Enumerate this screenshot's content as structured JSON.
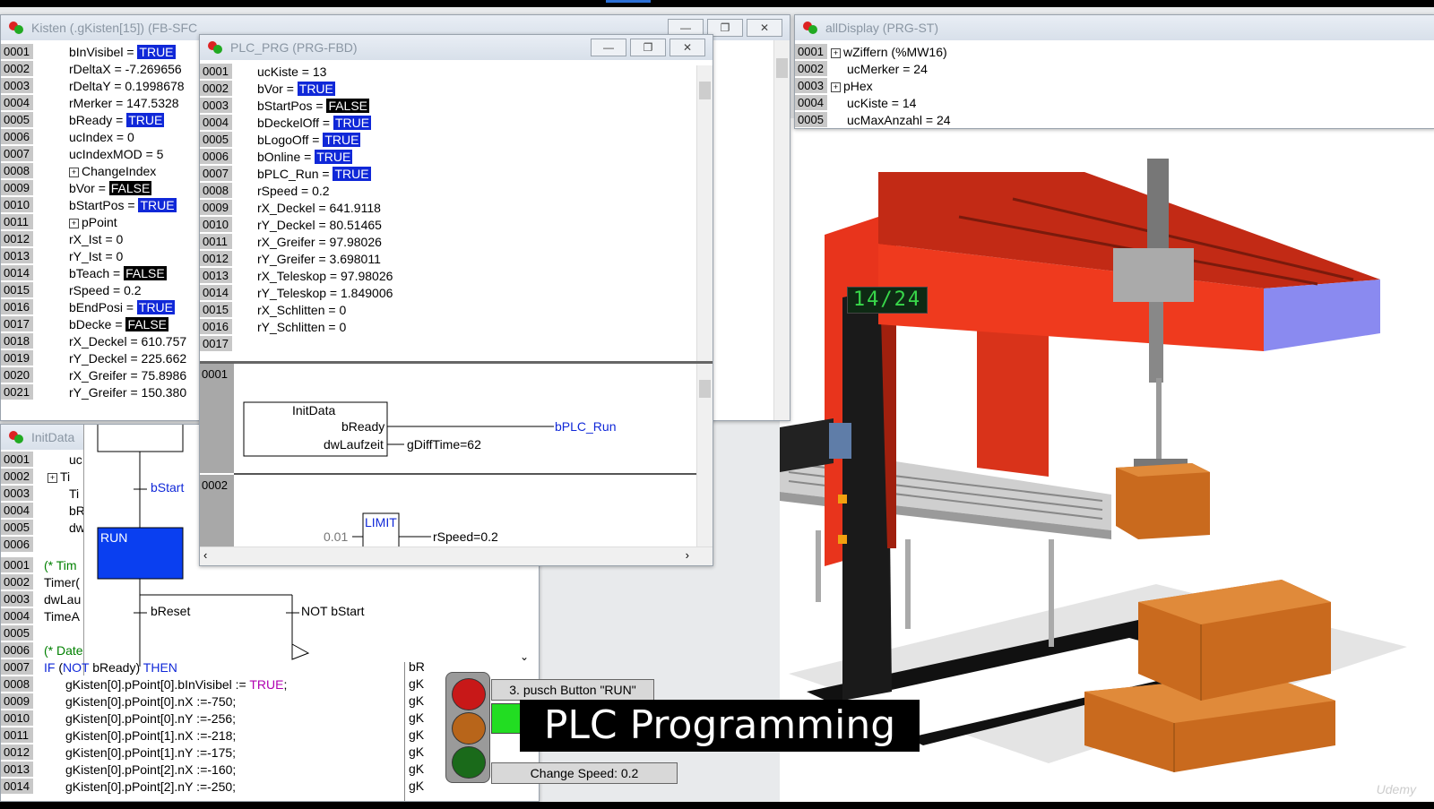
{
  "colors": {
    "highlight_true": "#1028d8",
    "highlight_false": "#000000",
    "run_step": "#0a3ff0",
    "beam": "#e8341c",
    "column_dark": "#1a1a1a",
    "box": "#c96a1e"
  },
  "windows": {
    "kisten": {
      "title": "Kisten (.gKisten[15]) (FB-SFC",
      "rows": [
        {
          "n": "0001",
          "pre": "bInVisibel = ",
          "val": "TRUE",
          "kind": "t"
        },
        {
          "n": "0002",
          "pre": "rDeltaX = -7.269656",
          "val": "",
          "kind": ""
        },
        {
          "n": "0003",
          "pre": "rDeltaY = 0.1998678",
          "val": "",
          "kind": ""
        },
        {
          "n": "0004",
          "pre": "rMerker = 147.5328",
          "val": "",
          "kind": ""
        },
        {
          "n": "0005",
          "pre": "bReady = ",
          "val": "TRUE",
          "kind": "t"
        },
        {
          "n": "0006",
          "pre": "ucIndex = 0",
          "val": "",
          "kind": ""
        },
        {
          "n": "0007",
          "pre": "ucIndexMOD = 5",
          "val": "",
          "kind": ""
        },
        {
          "n": "0008",
          "pre": "ChangeIndex",
          "val": "",
          "kind": "tree"
        },
        {
          "n": "0009",
          "pre": "bVor = ",
          "val": "FALSE",
          "kind": "f"
        },
        {
          "n": "0010",
          "pre": "bStartPos = ",
          "val": "TRUE",
          "kind": "t"
        },
        {
          "n": "0011",
          "pre": "pPoint",
          "val": "",
          "kind": "tree"
        },
        {
          "n": "0012",
          "pre": "rX_Ist = 0",
          "val": "",
          "kind": ""
        },
        {
          "n": "0013",
          "pre": "rY_Ist = 0",
          "val": "",
          "kind": ""
        },
        {
          "n": "0014",
          "pre": "bTeach = ",
          "val": "FALSE",
          "kind": "f"
        },
        {
          "n": "0015",
          "pre": "rSpeed = 0.2",
          "val": "",
          "kind": ""
        },
        {
          "n": "0016",
          "pre": "bEndPosi = ",
          "val": "TRUE",
          "kind": "t"
        },
        {
          "n": "0017",
          "pre": "bDecke = ",
          "val": "FALSE",
          "kind": "f"
        },
        {
          "n": "0018",
          "pre": "rX_Deckel = 610.757",
          "val": "",
          "kind": ""
        },
        {
          "n": "0019",
          "pre": "rY_Deckel = 225.662",
          "val": "",
          "kind": ""
        },
        {
          "n": "0020",
          "pre": "rX_Greifer = 75.8986",
          "val": "",
          "kind": ""
        },
        {
          "n": "0021",
          "pre": "rY_Greifer = 150.380",
          "val": "",
          "kind": ""
        }
      ]
    },
    "alldisplay": {
      "title": "allDisplay (PRG-ST)",
      "rows": [
        {
          "n": "0001",
          "text": "wZiffern (%MW16)",
          "tree": true
        },
        {
          "n": "0002",
          "text": "ucMerker = 24",
          "tree": false
        },
        {
          "n": "0003",
          "text": "pHex",
          "tree": true
        },
        {
          "n": "0004",
          "text": "ucKiste = 14",
          "tree": false
        },
        {
          "n": "0005",
          "text": "ucMaxAnzahl = 24",
          "tree": false
        }
      ]
    },
    "plcprg": {
      "title": "PLC_PRG (PRG-FBD)",
      "rows": [
        {
          "n": "0001",
          "pre": "ucKiste = 13",
          "val": "",
          "kind": ""
        },
        {
          "n": "0002",
          "pre": "bVor = ",
          "val": "TRUE",
          "kind": "t"
        },
        {
          "n": "0003",
          "pre": "bStartPos = ",
          "val": "FALSE",
          "kind": "f"
        },
        {
          "n": "0004",
          "pre": "bDeckelOff = ",
          "val": "TRUE",
          "kind": "t"
        },
        {
          "n": "0005",
          "pre": "bLogoOff = ",
          "val": "TRUE",
          "kind": "t"
        },
        {
          "n": "0006",
          "pre": "bOnline = ",
          "val": "TRUE",
          "kind": "t"
        },
        {
          "n": "0007",
          "pre": "bPLC_Run = ",
          "val": "TRUE",
          "kind": "t"
        },
        {
          "n": "0008",
          "pre": "rSpeed = 0.2",
          "val": "",
          "kind": ""
        },
        {
          "n": "0009",
          "pre": "rX_Deckel = 641.9118",
          "val": "",
          "kind": ""
        },
        {
          "n": "0010",
          "pre": "rY_Deckel = 80.51465",
          "val": "",
          "kind": ""
        },
        {
          "n": "0011",
          "pre": "rX_Greifer = 97.98026",
          "val": "",
          "kind": ""
        },
        {
          "n": "0012",
          "pre": "rY_Greifer = 3.698011",
          "val": "",
          "kind": ""
        },
        {
          "n": "0013",
          "pre": "rX_Teleskop = 97.98026",
          "val": "",
          "kind": ""
        },
        {
          "n": "0014",
          "pre": "rY_Teleskop = 1.849006",
          "val": "",
          "kind": ""
        },
        {
          "n": "0015",
          "pre": "rX_Schlitten = 0",
          "val": "",
          "kind": ""
        },
        {
          "n": "0016",
          "pre": "rY_Schlitten = 0",
          "val": "",
          "kind": ""
        },
        {
          "n": "0017",
          "pre": "",
          "val": "",
          "kind": ""
        }
      ],
      "fbd": {
        "net1_no": "0001",
        "block1": "InitData",
        "pin_ready": "bReady",
        "pin_laufzeit": "dwLaufzeit",
        "out_run": "bPLC_Run",
        "out_diff": "gDiffTime=62",
        "net2_no": "0002",
        "block2": "LIMIT",
        "in_min": "0.01",
        "out_speed": "rSpeed=0.2"
      }
    },
    "initdata": {
      "title": "InitData",
      "decl_rows": [
        {
          "n": "0001",
          "text": "uc"
        },
        {
          "n": "0002",
          "text": "Ti",
          "tree": true
        },
        {
          "n": "0003",
          "text": "Ti"
        },
        {
          "n": "0004",
          "text": "bR"
        },
        {
          "n": "0005",
          "text": "dw"
        },
        {
          "n": "0006",
          "text": ""
        }
      ],
      "code_rows_top": [
        {
          "n": "0001",
          "text": "(* Tim",
          "cm": true
        },
        {
          "n": "0002",
          "text": "Timer("
        },
        {
          "n": "0003",
          "text": "dwLau"
        },
        {
          "n": "0004",
          "text": "TimeA"
        },
        {
          "n": "0005",
          "text": ""
        },
        {
          "n": "0006",
          "text": "(* Date",
          "cm": true
        }
      ],
      "sfc": {
        "trans_start": "bStart",
        "step": "RUN",
        "trans_reset": "bReset",
        "trans_not": "NOT bStart"
      },
      "code_if": {
        "n": "0007",
        "kw1": "IF",
        "open": " (",
        "kw2": "NOT",
        "cond": " bReady) ",
        "kw3": "THEN"
      },
      "code_rows": [
        {
          "n": "0008",
          "a": "gKisten[0].pPoint[0].bInVisibel := ",
          "b": "TRUE",
          "c": ";"
        },
        {
          "n": "0009",
          "a": "gKisten[0].pPoint[0].nX :=-750;",
          "b": "",
          "c": ""
        },
        {
          "n": "0010",
          "a": "gKisten[0].pPoint[0].nY :=-256;",
          "b": "",
          "c": ""
        },
        {
          "n": "0011",
          "a": "gKisten[0].pPoint[1].nX :=-218;",
          "b": "",
          "c": ""
        },
        {
          "n": "0012",
          "a": "gKisten[0].pPoint[1].nY :=-175;",
          "b": "",
          "c": ""
        },
        {
          "n": "0013",
          "a": "gKisten[0].pPoint[2].nX :=-160;",
          "b": "",
          "c": ""
        },
        {
          "n": "0014",
          "a": "gKisten[0].pPoint[2].nY :=-250;",
          "b": "",
          "c": ""
        }
      ],
      "right_col": [
        "bR",
        "gK",
        "gK",
        "gK",
        "gK",
        "gK",
        "gK",
        "gK"
      ]
    }
  },
  "visu": {
    "instruction": "3. pusch Button \"RUN\"",
    "speed": "Change Speed: 0.2",
    "counter": "14/24",
    "caption": "PLC Programming",
    "watermark": "Udemy"
  }
}
